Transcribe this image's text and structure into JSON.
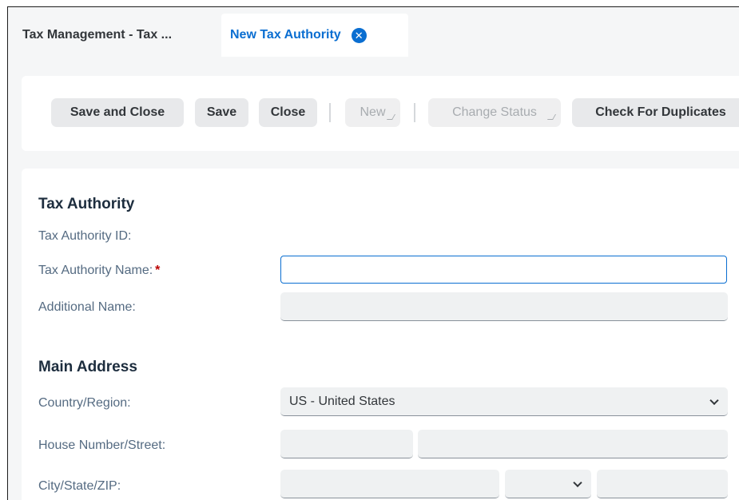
{
  "tabs": [
    {
      "label": "Tax Management - Tax ..."
    },
    {
      "label": "New Tax Authority",
      "close_icon": "x-circle-icon"
    }
  ],
  "toolbar": {
    "save_and_close": "Save and Close",
    "save": "Save",
    "close": "Close",
    "new": "New",
    "change_status": "Change Status",
    "check_duplicates": "Check For Duplicates"
  },
  "sections": {
    "tax_authority": {
      "title": "Tax Authority",
      "id_label": "Tax Authority ID:",
      "name_label": "Tax Authority Name:",
      "required_marker": "*",
      "additional_name_label": "Additional Name:"
    },
    "main_address": {
      "title": "Main Address",
      "country_label": "Country/Region:",
      "country_value": "US - United States",
      "street_label": "House Number/Street:",
      "city_label": "City/State/ZIP:"
    }
  },
  "colors": {
    "accent": "#0a6ed1",
    "required": "#bb0000",
    "background": "#f5f6f7"
  }
}
